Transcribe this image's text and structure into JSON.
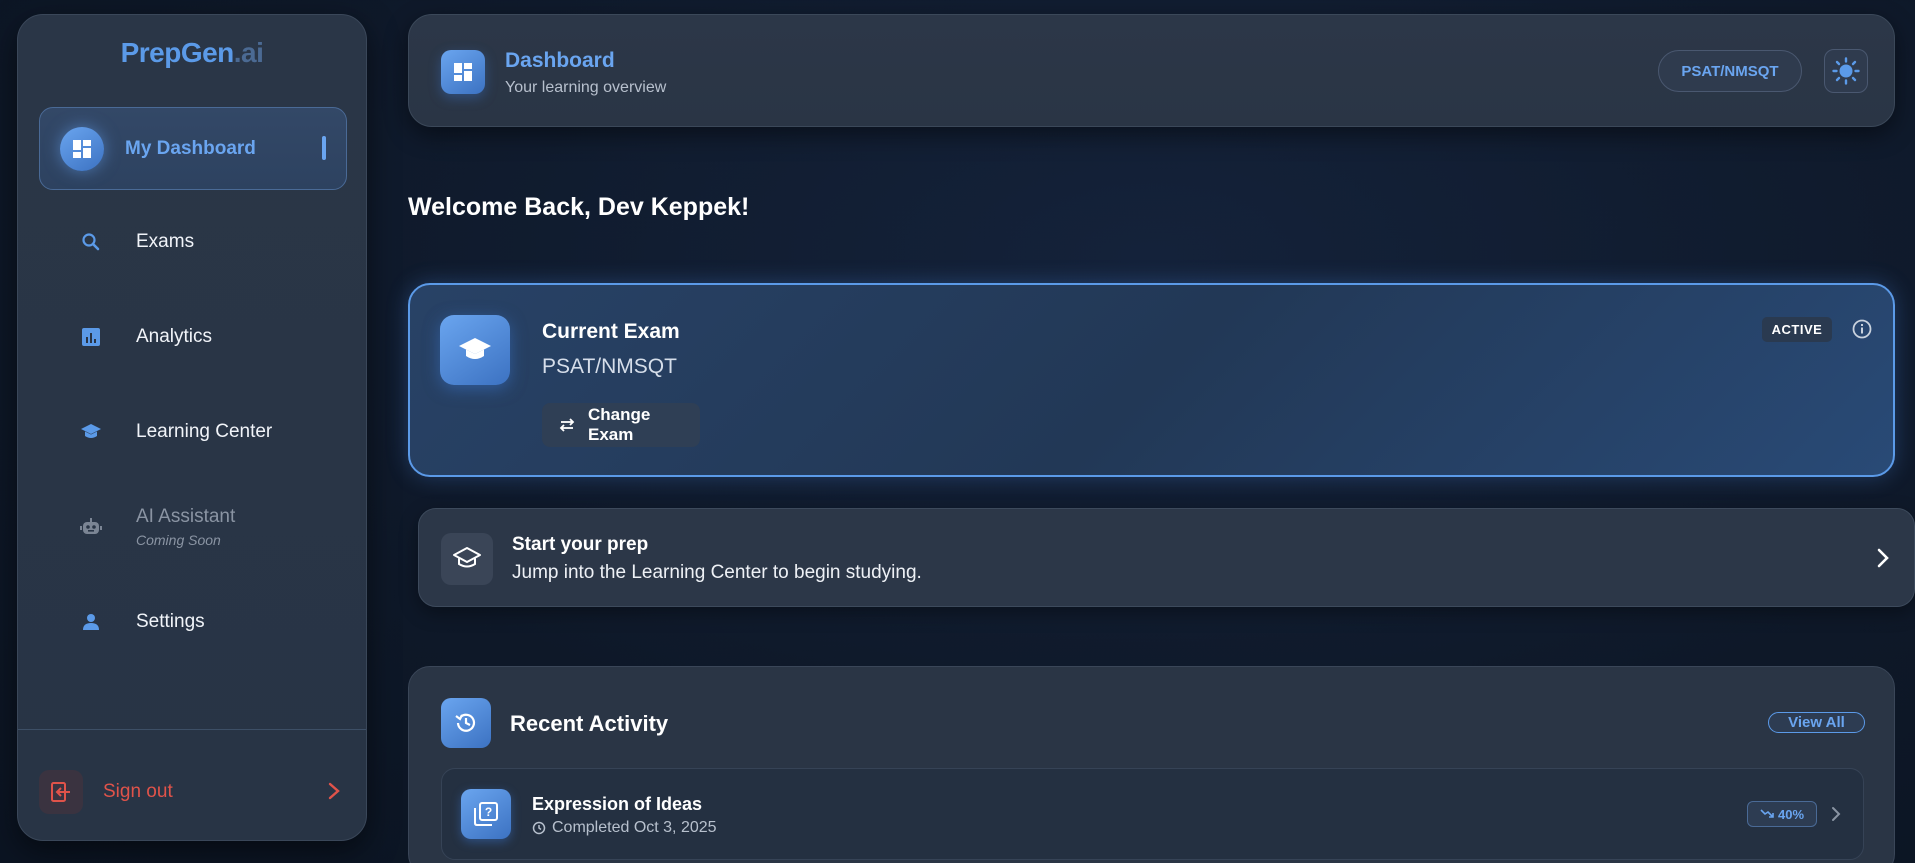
{
  "sidebar": {
    "logo": {
      "brand": "PrepGen",
      "suffix": ".ai"
    },
    "items": [
      {
        "label": "My Dashboard",
        "icon": "dashboard-icon",
        "active": true
      },
      {
        "label": "Exams",
        "icon": "search-icon"
      },
      {
        "label": "Analytics",
        "icon": "analytics-icon"
      },
      {
        "label": "Learning Center",
        "icon": "graduation-cap-icon"
      },
      {
        "label": "AI Assistant",
        "sublabel": "Coming Soon",
        "icon": "robot-icon",
        "disabled": true
      },
      {
        "label": "Settings",
        "icon": "person-icon"
      }
    ],
    "signout": {
      "label": "Sign out"
    }
  },
  "header": {
    "title": "Dashboard",
    "subtitle": "Your learning overview",
    "exam_pill": "PSAT/NMSQT",
    "theme_icon": "sun-icon"
  },
  "welcome": "Welcome Back, Dev Keppek!",
  "current_exam": {
    "title": "Current Exam",
    "name": "PSAT/NMSQT",
    "change_label": "Change Exam",
    "badge": "ACTIVE"
  },
  "prep": {
    "title": "Start your prep",
    "subtitle": "Jump into the Learning Center to begin studying."
  },
  "activity": {
    "title": "Recent Activity",
    "view_all": "View All",
    "items": [
      {
        "title": "Expression of Ideas",
        "meta": "Completed Oct 3, 2025",
        "score": "40%"
      }
    ]
  },
  "colors": {
    "accent": "#5b9ae8",
    "danger": "#e0534a",
    "background": "#0e1828",
    "card": "#2a3545"
  }
}
